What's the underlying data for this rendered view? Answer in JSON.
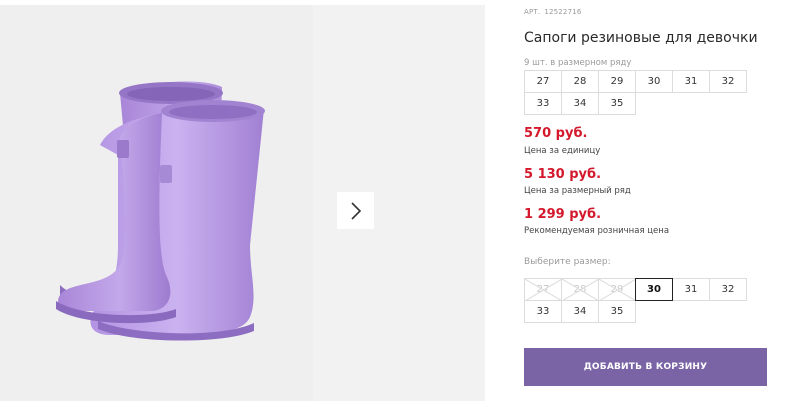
{
  "product": {
    "art_label": "АРТ.",
    "art_number": "12522716",
    "title": "Сапоги резиновые для девочки"
  },
  "pack": {
    "label": "9 шт. в размерном ряду",
    "sizes": [
      "27",
      "28",
      "29",
      "30",
      "31",
      "32",
      "33",
      "34",
      "35"
    ]
  },
  "prices": [
    {
      "value": "570 руб.",
      "note": "Цена за единицу"
    },
    {
      "value": "5 130 руб.",
      "note": "Цена за размерный ряд"
    },
    {
      "value": "1 299 руб.",
      "note": "Рекомендуемая розничная цена"
    }
  ],
  "size_picker": {
    "label": "Выберите размер:",
    "sizes": [
      {
        "label": "27",
        "state": "disabled"
      },
      {
        "label": "28",
        "state": "disabled"
      },
      {
        "label": "29",
        "state": "disabled"
      },
      {
        "label": "30",
        "state": "selected"
      },
      {
        "label": "31",
        "state": "available"
      },
      {
        "label": "32",
        "state": "available"
      },
      {
        "label": "33",
        "state": "available"
      },
      {
        "label": "34",
        "state": "available"
      },
      {
        "label": "35",
        "state": "available"
      }
    ]
  },
  "cart": {
    "button_label": "ДОБАВИТЬ В КОРЗИНУ"
  },
  "gallery": {
    "next_icon": "chevron-right-icon"
  },
  "colors": {
    "accent": "#7a64a6",
    "price": "#d4192d",
    "boot": "#b79be0"
  }
}
